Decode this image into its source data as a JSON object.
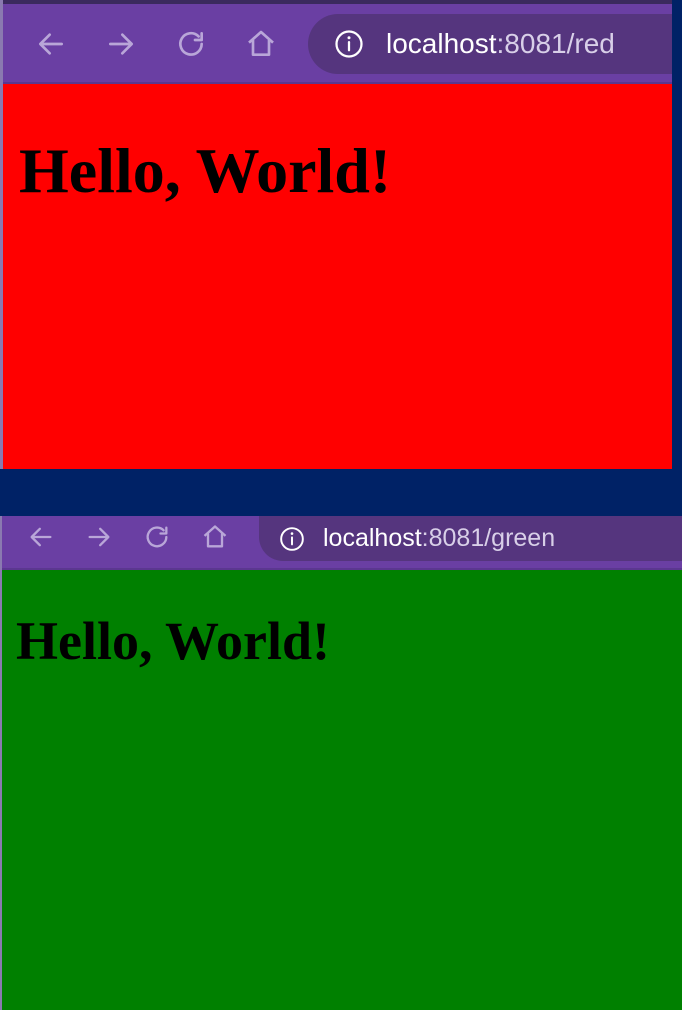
{
  "windows": [
    {
      "url_host": "localhost",
      "url_rest": ":8081/red",
      "heading": "Hello, World!",
      "background": "#ff0000",
      "icons": [
        "back-arrow-icon",
        "forward-arrow-icon",
        "reload-icon",
        "home-icon",
        "info-icon"
      ]
    },
    {
      "url_host": "localhost",
      "url_rest": ":8081/green",
      "heading": "Hello, World!",
      "background": "#008000",
      "icons": [
        "back-arrow-icon",
        "forward-arrow-icon",
        "reload-icon",
        "home-icon",
        "info-icon"
      ]
    }
  ],
  "colors": {
    "desktop": "#002266",
    "toolbar": "#6a3fa3",
    "urlbar": "#55357e",
    "icon": "#b9a6d8"
  }
}
